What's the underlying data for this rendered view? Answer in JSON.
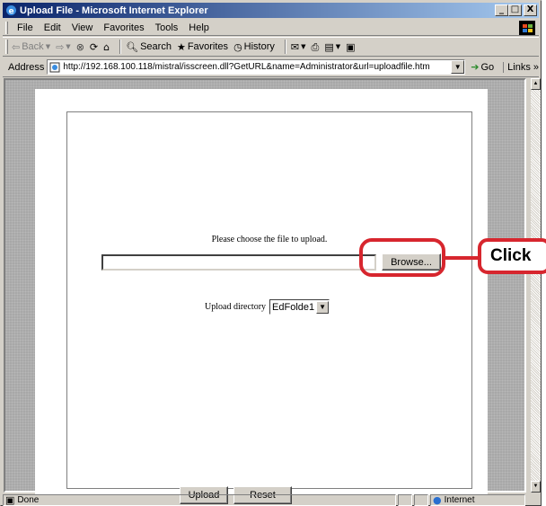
{
  "window": {
    "title": "Upload File - Microsoft Internet Explorer",
    "minimize_label": "_",
    "maximize_label": "□",
    "close_label": "X"
  },
  "menu": [
    "File",
    "Edit",
    "View",
    "Favorites",
    "Tools",
    "Help"
  ],
  "toolbar": {
    "back_label": "Back",
    "search_label": "Search",
    "favorites_label": "Favorites",
    "history_label": "History"
  },
  "address": {
    "label": "Address",
    "url": "http://192.168.100.118/mistral/isscreen.dll?GetURL&name=Administrator&url=uploadfile.htm",
    "go_label": "Go",
    "links_label": "Links »"
  },
  "form": {
    "prompt": "Please choose the file to upload.",
    "file_value": "",
    "browse_label": "Browse...",
    "directory_label": "Upload directory",
    "directory_value": "EdFolde1",
    "upload_label": "Upload",
    "reset_label": "Reset"
  },
  "status": {
    "text": "Done",
    "zone": "Internet"
  },
  "annotation": {
    "callout_text": "Click",
    "color": "#d7262e"
  },
  "colors": {
    "titlebar_start": "#0a246a",
    "titlebar_end": "#a6caf0",
    "chrome": "#d4d0c8"
  }
}
